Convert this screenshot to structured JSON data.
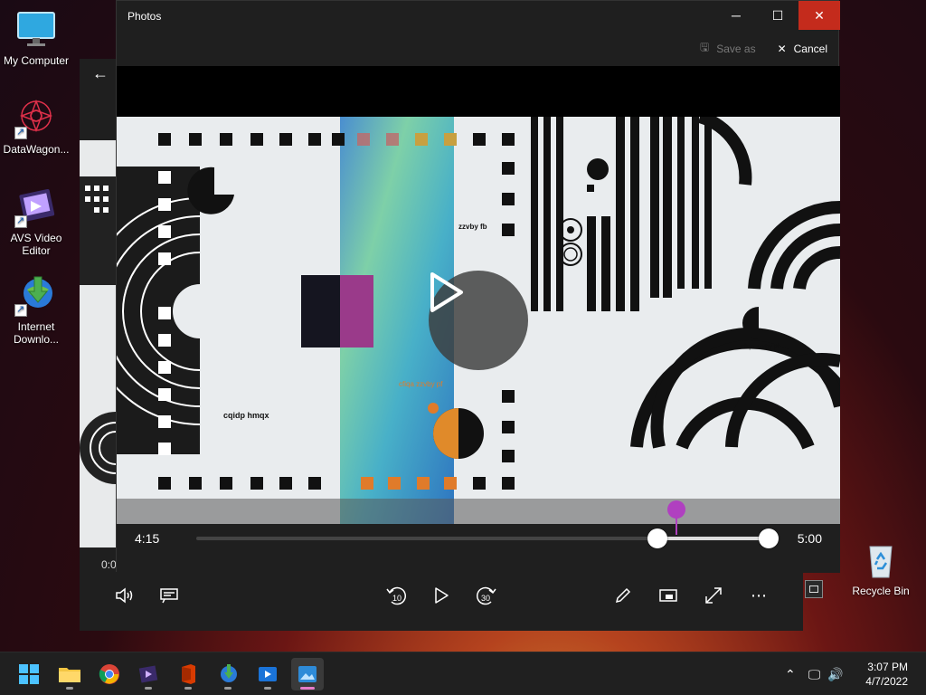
{
  "desktop": {
    "icons": [
      {
        "label": "My Computer"
      },
      {
        "label": "DataWagon..."
      },
      {
        "label": "AVS Video Editor"
      },
      {
        "label": "Internet Downlo..."
      },
      {
        "label": "Recycle Bin"
      }
    ]
  },
  "back_window": {
    "time": "0:0"
  },
  "photos": {
    "title": "Photos",
    "toolbar": {
      "save_as": "Save as",
      "cancel": "Cancel"
    },
    "video_text": {
      "t1": "cqidp hmqx",
      "t2": "zzvby fb",
      "t3": "cfiqa zzvby pf",
      "t4": "cfiqa zzvby pf"
    },
    "seek": {
      "current": "4:15",
      "end": "5:00",
      "trim_start_pct": 0.805,
      "trim_end_pct": 0.998,
      "playhead_pct": 0.837
    }
  },
  "taskbar": {
    "apps": [
      {
        "name": "start-icon"
      },
      {
        "name": "file-explorer-icon"
      },
      {
        "name": "chrome-icon"
      },
      {
        "name": "avs-video-icon"
      },
      {
        "name": "office-icon"
      },
      {
        "name": "internet-download-icon"
      },
      {
        "name": "video-editor-icon"
      },
      {
        "name": "photos-icon"
      }
    ],
    "time": "3:07 PM",
    "date": "4/7/2022"
  },
  "colors": {
    "close_red": "#c42b1c",
    "accent_purple": "#b040c0"
  }
}
